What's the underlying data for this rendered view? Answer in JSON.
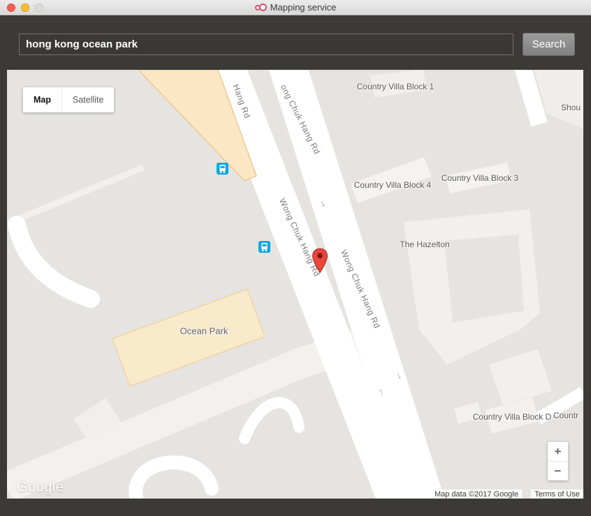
{
  "window": {
    "title": "Mapping service",
    "app_icon": "linked-rings-icon",
    "traffic_lights": [
      "close-button",
      "minimize-button",
      "zoom-button-disabled"
    ]
  },
  "toolbar": {
    "search_value": "hong kong ocean park",
    "search_button": "Search"
  },
  "map": {
    "type_control": {
      "map": "Map",
      "satellite": "Satellite"
    },
    "zoom_control": {
      "zoom_in": "+",
      "zoom_out": "−"
    },
    "watermark": "Google",
    "attribution": {
      "map_data": "Map data ©2017 Google",
      "terms_of_use": "Terms of Use"
    },
    "places": {
      "block1": "Country Villa Block 1",
      "block4": "Country Villa Block 4",
      "block3": "Country Villa Block 3",
      "hazelton": "The Hazelton",
      "ocean_park": "Ocean Park",
      "block_d": "Country Villa Block D",
      "shou_clipped": "Shou",
      "countr_clipped": "Countr"
    },
    "roads": {
      "top_left": "Hang Rd",
      "top": "ong Chuk Hang Rd",
      "middle": "Wong Chuk Hang Rd",
      "lower": "Wong Chuk Hang Rd"
    },
    "icons": {
      "marker": "red-location-pin-icon",
      "bus_stop": "bus-icon",
      "one_way_down": "↓",
      "one_way_up": "↑"
    }
  },
  "colors": {
    "marker_red": "#e8453c",
    "bus_blue": "#0ba7e8",
    "poi_beige": "#fbe7c4",
    "map_gray": "#e5e4e0",
    "close_red": "#f35f57",
    "minimize_yellow": "#f8bd2f"
  }
}
